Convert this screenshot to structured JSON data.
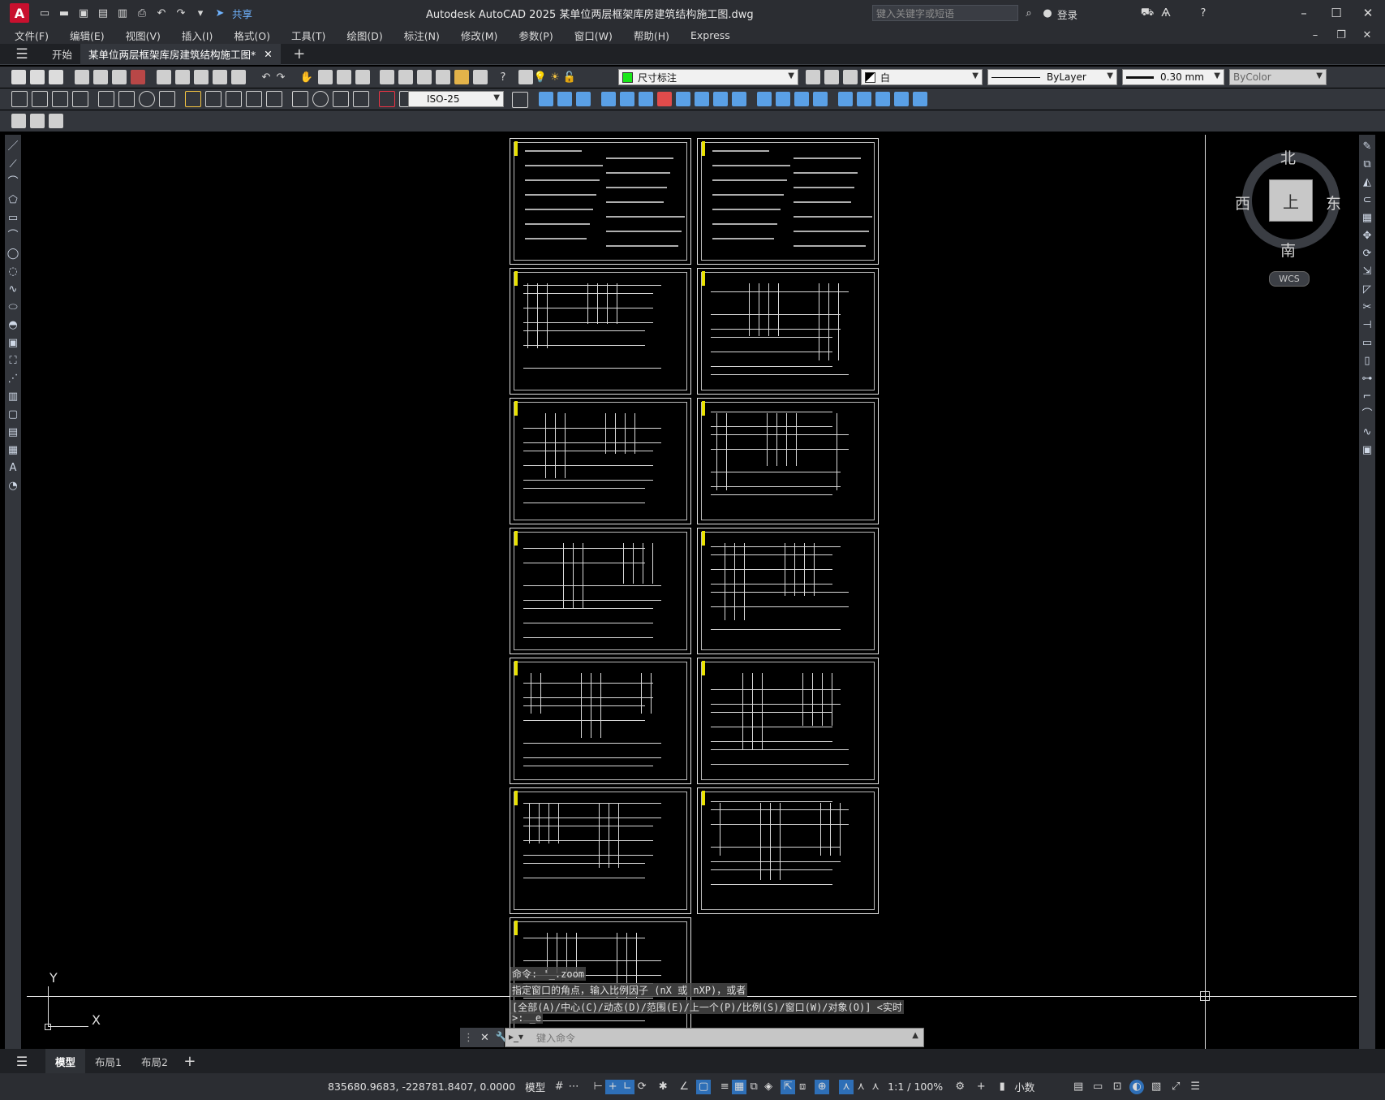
{
  "app": {
    "logo_letter": "A",
    "title": "Autodesk AutoCAD 2025    某单位两层框架库房建筑结构施工图.dwg",
    "share_label": "共享",
    "search_placeholder": "键入关键字或短语",
    "login_label": "登录"
  },
  "menu": [
    "文件(F)",
    "编辑(E)",
    "视图(V)",
    "插入(I)",
    "格式(O)",
    "工具(T)",
    "绘图(D)",
    "标注(N)",
    "修改(M)",
    "参数(P)",
    "窗口(W)",
    "帮助(H)",
    "Express"
  ],
  "tabs": {
    "start": "开始",
    "active_doc": "某单位两层框架库房建筑结构施工图*"
  },
  "properties": {
    "layer": "尺寸标注",
    "color": "白",
    "linetype": "ByLayer",
    "lineweight": "0.30 mm",
    "plotstyle": "ByColor",
    "dimstyle": "ISO-25"
  },
  "viewcube": {
    "north": "北",
    "south": "南",
    "east": "东",
    "west": "西",
    "face": "上",
    "wcs": "WCS"
  },
  "ucs": {
    "x": "X",
    "y": "Y"
  },
  "command": {
    "line1": "命令: '_.zoom",
    "line2": "指定窗口的角点，输入比例因子 (nX 或 nXP)，或者",
    "line3": "[全部(A)/中心(C)/动态(D)/范围(E)/上一个(P)/比例(S)/窗口(W)/对象(O)] <实时",
    "line4": ">: _e",
    "placeholder": "键入命令"
  },
  "layouts": [
    "模型",
    "布局1",
    "布局2"
  ],
  "status": {
    "coords": "835680.9683, -228781.8407, 0.0000",
    "space": "模型",
    "scale": "1:1 / 100%",
    "units": "小数"
  }
}
